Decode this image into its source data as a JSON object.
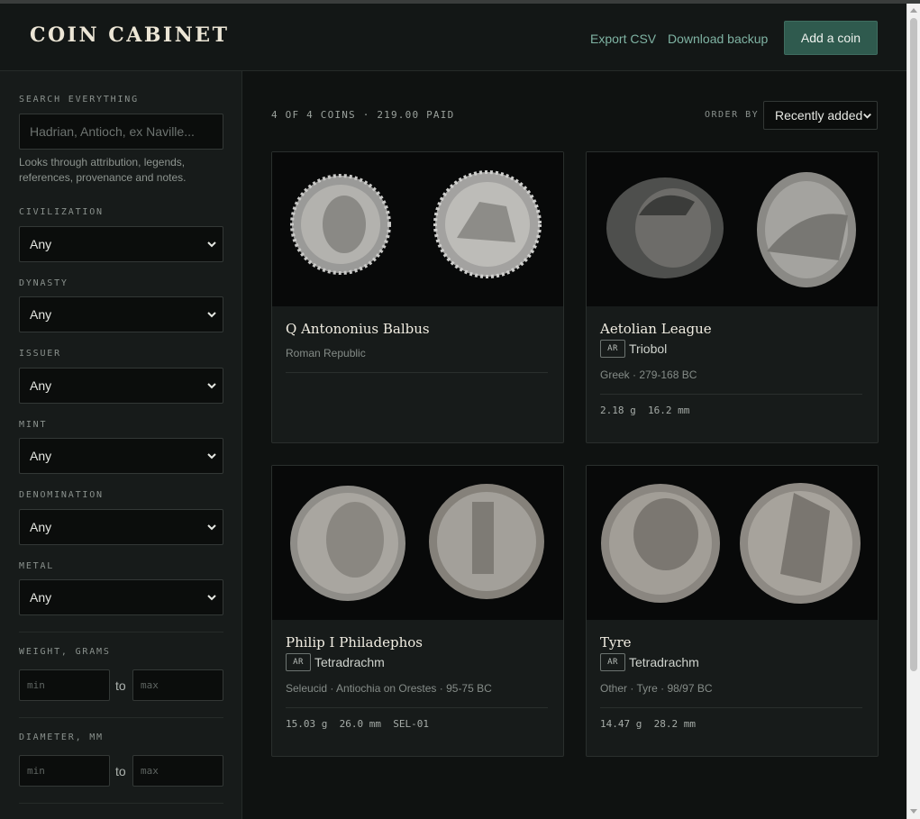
{
  "header": {
    "brand": "COIN CABINET",
    "export_csv": "Export CSV",
    "download_backup": "Download backup",
    "add_coin": "Add a coin"
  },
  "sidebar": {
    "search_label": "SEARCH EVERYTHING",
    "search_placeholder": "Hadrian, Antioch, ex Naville...",
    "search_hint": "Looks through attribution, legends, references, provenance and notes.",
    "filters": [
      {
        "label": "CIVILIZATION",
        "value": "Any"
      },
      {
        "label": "DYNASTY",
        "value": "Any"
      },
      {
        "label": "ISSUER",
        "value": "Any"
      },
      {
        "label": "MINT",
        "value": "Any"
      },
      {
        "label": "DENOMINATION",
        "value": "Any"
      },
      {
        "label": "METAL",
        "value": "Any"
      }
    ],
    "weight": {
      "label": "WEIGHT, GRAMS",
      "min_placeholder": "min",
      "max_placeholder": "max",
      "to": "to"
    },
    "diameter": {
      "label": "DIAMETER, MM",
      "min_placeholder": "min",
      "max_placeholder": "max",
      "to": "to"
    }
  },
  "main": {
    "count_text": "4 OF 4 COINS · 219.00 PAID",
    "order_label": "ORDER BY",
    "order_value": "Recently added"
  },
  "coins": [
    {
      "title": "Q Antononius Balbus",
      "metal": "",
      "denomination": "",
      "meta": "Roman Republic",
      "specs": ""
    },
    {
      "title": "Aetolian League",
      "metal": "AR",
      "denomination": "Triobol",
      "meta": "Greek · 279-168 BC",
      "specs": "2.18 g  16.2 mm"
    },
    {
      "title": "Philip I Philadephos",
      "metal": "AR",
      "denomination": "Tetradrachm",
      "meta": "Seleucid · Antiochia on Orestes · 95-75 BC",
      "specs": "15.03 g  26.0 mm  SEL-01"
    },
    {
      "title": "Tyre",
      "metal": "AR",
      "denomination": "Tetradrachm",
      "meta": "Other · Tyre · 98/97 BC",
      "specs": "14.47 g  28.2 mm"
    }
  ],
  "colors": {
    "accent": "#2f5a4e",
    "link": "#7fb3a3",
    "background": "#0f1211",
    "panel": "#171b1a"
  }
}
